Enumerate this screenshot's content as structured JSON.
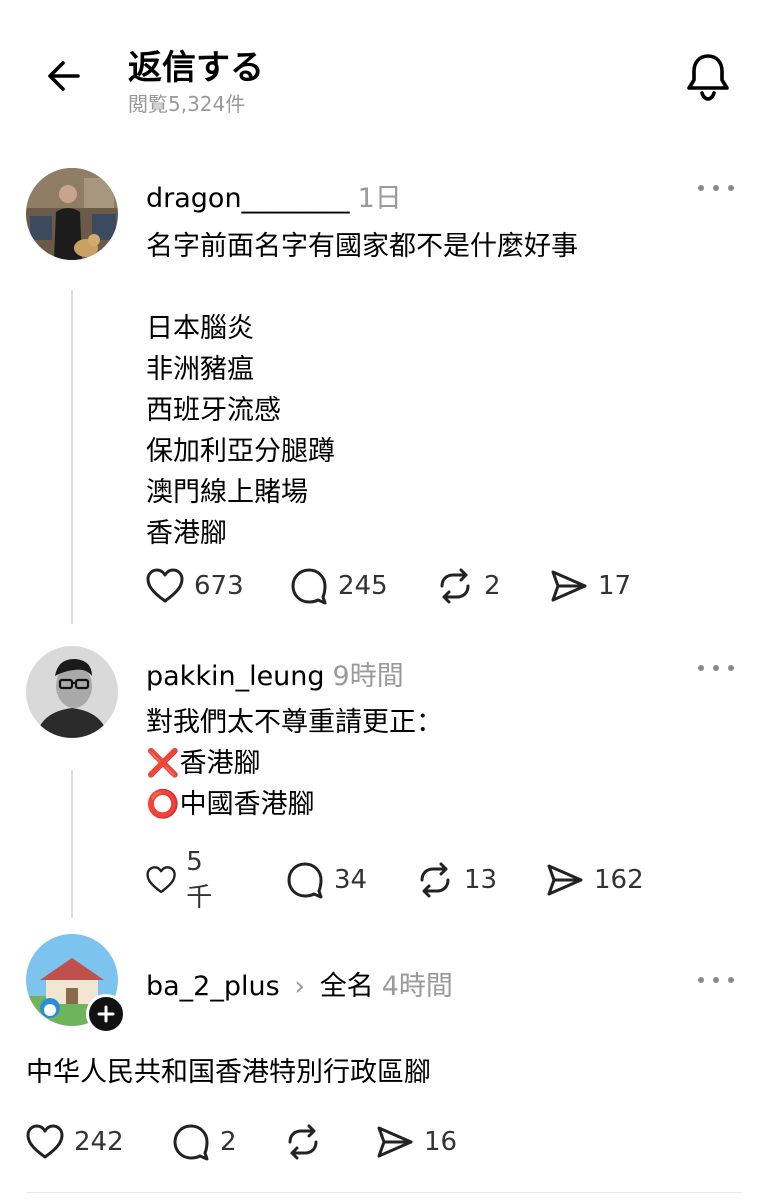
{
  "header": {
    "title": "返信する",
    "views": "閲覧5,324件"
  },
  "posts": [
    {
      "username": "dragon________",
      "time": "1日",
      "text": "名字前面名字有國家都不是什麼好事\n\n日本腦炎\n非洲豬瘟\n西班牙流感\n保加利亞分腿蹲\n澳門線上賭場\n香港腳",
      "likes": "673",
      "comments": "245",
      "reposts": "2",
      "shares": "17"
    },
    {
      "username": "pakkin_leung",
      "time": "9時間",
      "text": "對我們太不尊重請更正：\n❌香港腳\n⭕中國香港腳",
      "likes": "5千",
      "comments": "34",
      "reposts": "13",
      "shares": "162"
    },
    {
      "username": "ba_2_plus",
      "separator_glyph": "›",
      "display_name": "全名",
      "time": "4時間",
      "text": "中华人民共和国香港特別行政區腳",
      "likes": "242",
      "comments": "2",
      "reposts": "",
      "shares": "16"
    }
  ],
  "icons": {
    "back": "arrow-left-icon",
    "notification": "bell-icon",
    "more": "more-horizontal-icon",
    "like": "heart-icon",
    "comment": "comment-bubble-icon",
    "repost": "repost-icon",
    "share": "send-icon",
    "follow": "plus-icon"
  }
}
